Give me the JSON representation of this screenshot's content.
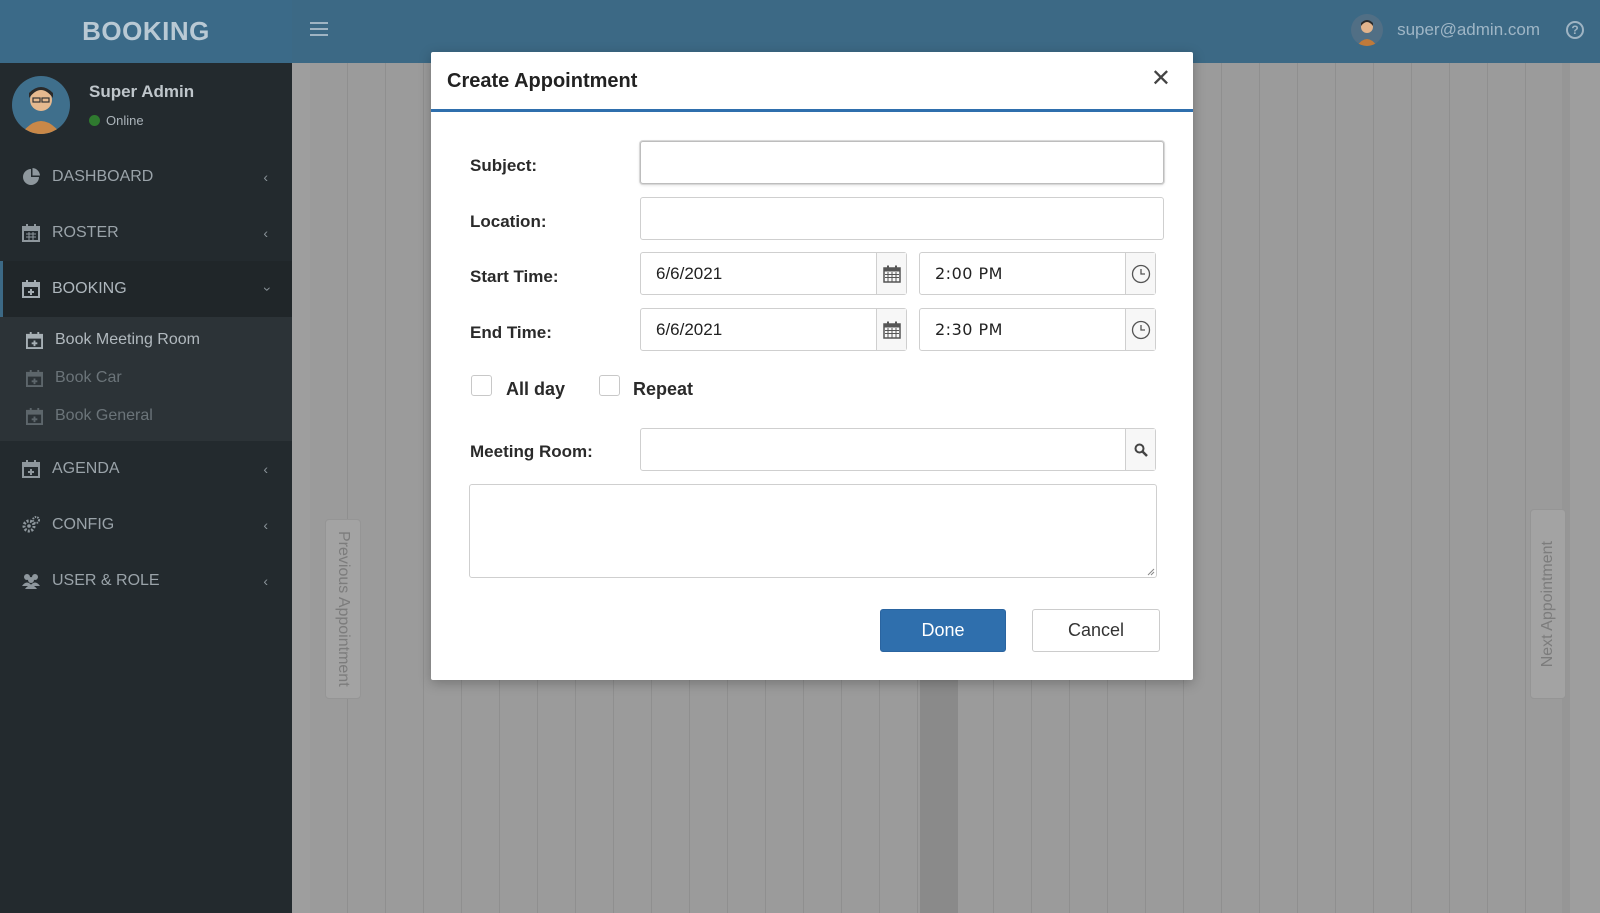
{
  "app": {
    "brand": "BOOKING"
  },
  "header": {
    "user_email": "super@admin.com"
  },
  "user": {
    "name": "Super Admin",
    "status": "Online"
  },
  "sidebar": {
    "items": [
      {
        "label": "DASHBOARD",
        "icon": "pie-chart-icon"
      },
      {
        "label": "ROSTER",
        "icon": "calendar-icon"
      },
      {
        "label": "BOOKING",
        "icon": "calendar-plus-icon"
      },
      {
        "label": "AGENDA",
        "icon": "calendar-plus-icon"
      },
      {
        "label": "CONFIG",
        "icon": "gears-icon"
      },
      {
        "label": "USER & ROLE",
        "icon": "users-icon"
      }
    ],
    "booking_sub": [
      {
        "label": "Book Meeting Room"
      },
      {
        "label": "Book Car"
      },
      {
        "label": "Book General"
      }
    ]
  },
  "calendar": {
    "prev_label": "Previous Appointment",
    "next_label": "Next Appointment"
  },
  "modal": {
    "title": "Create Appointment",
    "subject_label": "Subject:",
    "subject_value": "",
    "location_label": "Location:",
    "location_value": "",
    "start_label": "Start Time:",
    "start_date": "6/6/2021",
    "start_time": "2:00 PM",
    "end_label": "End Time:",
    "end_date": "6/6/2021",
    "end_time": "2:30 PM",
    "allday_label": "All day",
    "repeat_label": "Repeat",
    "room_label": "Meeting Room:",
    "room_value": "",
    "done_label": "Done",
    "cancel_label": "Cancel"
  },
  "colors": {
    "header_bg": "#3c6985",
    "sidebar_bg": "#232a2e",
    "primary_button": "#2f6fad",
    "status_online": "#2f7a2f"
  }
}
